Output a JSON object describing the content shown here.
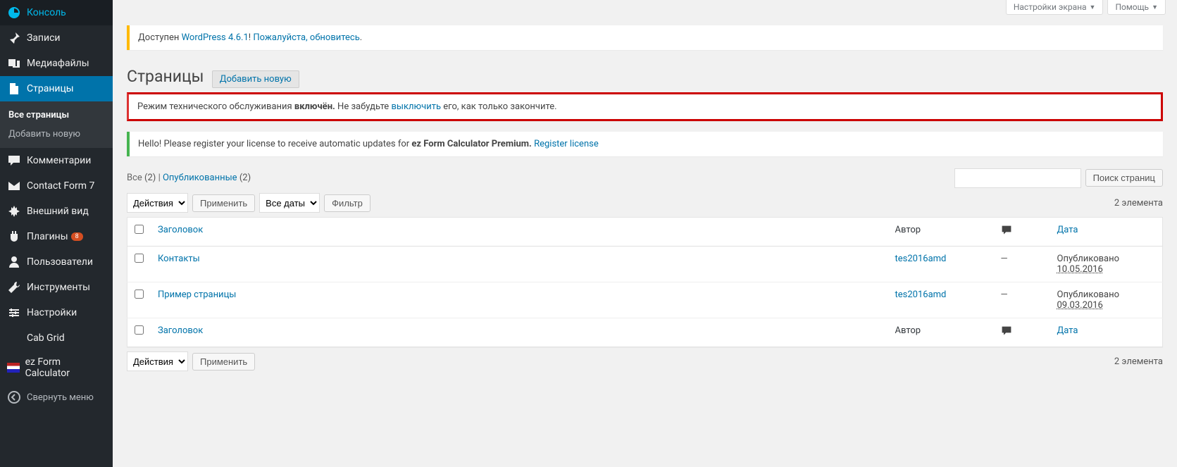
{
  "screen_meta": {
    "screen_options": "Настройки экрана",
    "help": "Помощь"
  },
  "sidebar": {
    "items": [
      {
        "id": "dashboard",
        "label": "Консоль"
      },
      {
        "id": "posts",
        "label": "Записи"
      },
      {
        "id": "media",
        "label": "Медиафайлы"
      },
      {
        "id": "pages",
        "label": "Страницы",
        "current": true
      },
      {
        "id": "comments",
        "label": "Комментарии"
      },
      {
        "id": "cf7",
        "label": "Contact Form 7"
      },
      {
        "id": "appearance",
        "label": "Внешний вид"
      },
      {
        "id": "plugins",
        "label": "Плагины",
        "badge": "8"
      },
      {
        "id": "users",
        "label": "Пользователи"
      },
      {
        "id": "tools",
        "label": "Инструменты"
      },
      {
        "id": "settings",
        "label": "Настройки"
      },
      {
        "id": "cabgrid",
        "label": "Cab Grid"
      },
      {
        "id": "ezfc",
        "label": "ez Form Calculator"
      }
    ],
    "pages_submenu": [
      {
        "label": "Все страницы",
        "current": true
      },
      {
        "label": "Добавить новую"
      }
    ],
    "collapse_label": "Свернуть меню"
  },
  "notices": {
    "update_pre": "Доступен ",
    "update_link1": "WordPress 4.6.1",
    "update_mid": "! ",
    "update_link2": "Пожалуйста, обновитесь",
    "update_post": ".",
    "maint_pre": "Режим технического обслуживания ",
    "maint_bold": "включён.",
    "maint_mid": " Не забудьте ",
    "maint_link": "выключить",
    "maint_post": " его, как только закончите.",
    "ezfc_pre": "Hello! Please register your license to receive automatic updates for ",
    "ezfc_bold": "ez Form Calculator Premium.",
    "ezfc_space": " ",
    "ezfc_link": "Register license"
  },
  "header": {
    "title": "Страницы",
    "add_new": "Добавить новую"
  },
  "filters": {
    "all_label": "Все",
    "all_count": "(2)",
    "sep": "  |  ",
    "published_label": "Опубликованные",
    "published_count": "(2)"
  },
  "search": {
    "button": "Поиск страниц"
  },
  "bulk": {
    "actions_label": "Действия",
    "apply": "Применить",
    "all_dates": "Все даты",
    "filter": "Фильтр"
  },
  "tablenav": {
    "count": "2 элемента"
  },
  "table": {
    "columns": {
      "title": "Заголовок",
      "author": "Автор",
      "date": "Дата"
    },
    "rows": [
      {
        "title": "Контакты",
        "author": "tes2016amd",
        "comments": "—",
        "date_status": "Опубликовано",
        "date": "10.05.2016"
      },
      {
        "title": "Пример страницы",
        "author": "tes2016amd",
        "comments": "—",
        "date_status": "Опубликовано",
        "date": "09.03.2016"
      }
    ]
  }
}
